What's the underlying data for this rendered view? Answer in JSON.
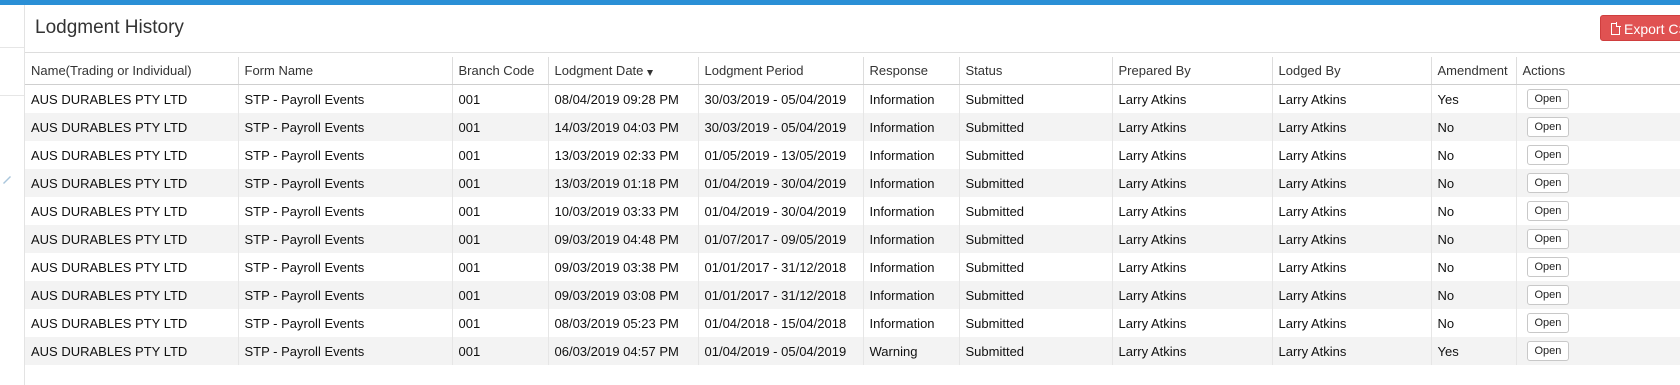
{
  "panel": {
    "title": "Lodgment History",
    "export_label": "Export CSV"
  },
  "table": {
    "columns": [
      "Name(Trading or Individual)",
      "Form Name",
      "Branch Code",
      "Lodgment Date",
      "Lodgment Period",
      "Response",
      "Status",
      "Prepared By",
      "Lodged By",
      "Amendment",
      "Actions"
    ],
    "sorted_column": "Lodgment Date",
    "sort_direction": "descending",
    "action_label": "Open",
    "rows": [
      [
        "AUS DURABLES PTY LTD",
        "STP - Payroll Events",
        "001",
        "08/04/2019 09:28 PM",
        "30/03/2019 - 05/04/2019",
        "Information",
        "Submitted",
        "Larry Atkins",
        "Larry Atkins",
        "Yes"
      ],
      [
        "AUS DURABLES PTY LTD",
        "STP - Payroll Events",
        "001",
        "14/03/2019 04:03 PM",
        "30/03/2019 - 05/04/2019",
        "Information",
        "Submitted",
        "Larry Atkins",
        "Larry Atkins",
        "No"
      ],
      [
        "AUS DURABLES PTY LTD",
        "STP - Payroll Events",
        "001",
        "13/03/2019 02:33 PM",
        "01/05/2019 - 13/05/2019",
        "Information",
        "Submitted",
        "Larry Atkins",
        "Larry Atkins",
        "No"
      ],
      [
        "AUS DURABLES PTY LTD",
        "STP - Payroll Events",
        "001",
        "13/03/2019 01:18 PM",
        "01/04/2019 - 30/04/2019",
        "Information",
        "Submitted",
        "Larry Atkins",
        "Larry Atkins",
        "No"
      ],
      [
        "AUS DURABLES PTY LTD",
        "STP - Payroll Events",
        "001",
        "10/03/2019 03:33 PM",
        "01/04/2019 - 30/04/2019",
        "Information",
        "Submitted",
        "Larry Atkins",
        "Larry Atkins",
        "No"
      ],
      [
        "AUS DURABLES PTY LTD",
        "STP - Payroll Events",
        "001",
        "09/03/2019 04:48 PM",
        "01/07/2017 - 09/05/2019",
        "Information",
        "Submitted",
        "Larry Atkins",
        "Larry Atkins",
        "No"
      ],
      [
        "AUS DURABLES PTY LTD",
        "STP - Payroll Events",
        "001",
        "09/03/2019 03:38 PM",
        "01/01/2017 - 31/12/2018",
        "Information",
        "Submitted",
        "Larry Atkins",
        "Larry Atkins",
        "No"
      ],
      [
        "AUS DURABLES PTY LTD",
        "STP - Payroll Events",
        "001",
        "09/03/2019 03:08 PM",
        "01/01/2017 - 31/12/2018",
        "Information",
        "Submitted",
        "Larry Atkins",
        "Larry Atkins",
        "No"
      ],
      [
        "AUS DURABLES PTY LTD",
        "STP - Payroll Events",
        "001",
        "08/03/2019 05:23 PM",
        "01/04/2018 - 15/04/2018",
        "Information",
        "Submitted",
        "Larry Atkins",
        "Larry Atkins",
        "No"
      ],
      [
        "AUS DURABLES PTY LTD",
        "STP - Payroll Events",
        "001",
        "06/03/2019 04:57 PM",
        "01/04/2019 - 05/04/2019",
        "Warning",
        "Submitted",
        "Larry Atkins",
        "Larry Atkins",
        "Yes"
      ]
    ]
  },
  "colors": {
    "topbar": "#2a8fd6",
    "export_button": "#e05252",
    "row_stripe": "#f3f3f3"
  },
  "icons": {
    "export": "file-icon",
    "sort": "sort-desc-icon",
    "gutter": "pencil-icon"
  }
}
